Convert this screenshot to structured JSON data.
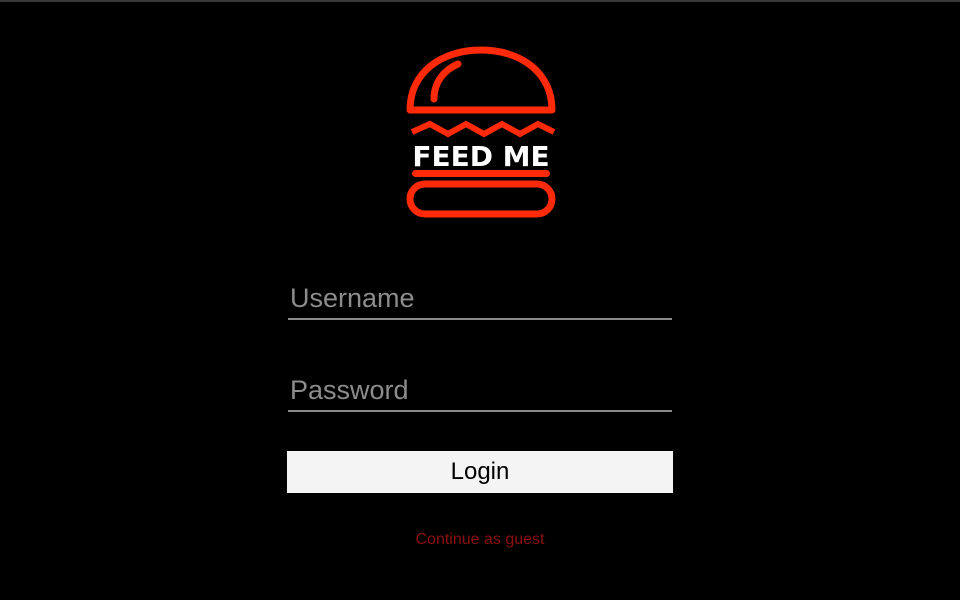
{
  "brand": {
    "logo_text": "FEED ME",
    "logo_color": "#ff2a0a",
    "logo_icon": "burger-icon"
  },
  "login_form": {
    "username_placeholder": "Username",
    "username_value": "",
    "password_placeholder": "Password",
    "password_value": "",
    "login_label": "Login",
    "guest_link_label": "Continue as guest"
  },
  "colors": {
    "background": "#000000",
    "field_underline": "#8a8a8a",
    "button_background": "#f4f4f4",
    "guest_link": "#8c1010"
  }
}
